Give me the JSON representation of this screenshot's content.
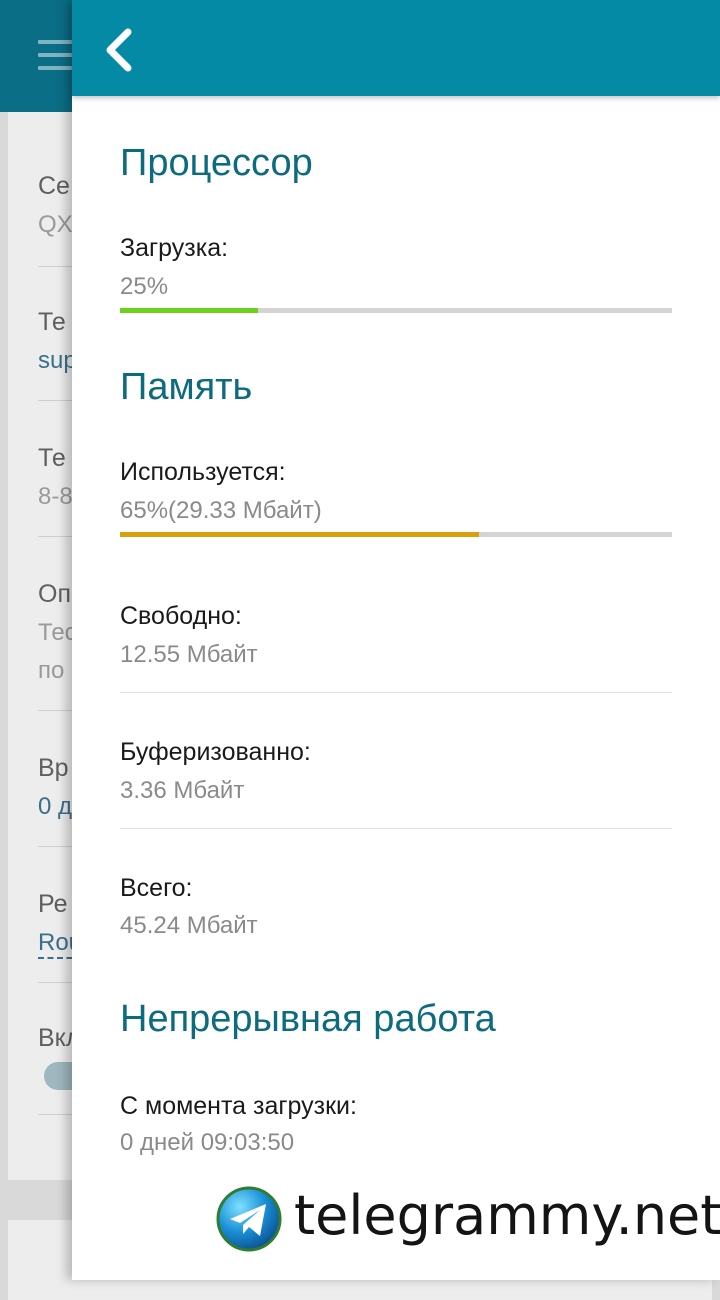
{
  "background": {
    "rows": [
      {
        "label": "Се",
        "value": "QX"
      },
      {
        "label": "Те",
        "value": "sup"
      },
      {
        "label": "Те",
        "value": "8-8"
      },
      {
        "label": "Оп",
        "value": "Тес",
        "value2": "по"
      },
      {
        "label": "Вр",
        "value": "0 д"
      },
      {
        "label": "Ре",
        "value": "Rou"
      },
      {
        "label": "Вкл"
      }
    ]
  },
  "cpu": {
    "title": "Процессор",
    "load_label": "Загрузка:",
    "load_value": "25%",
    "load_fraction": 0.25,
    "bar_color": "#6cd11a"
  },
  "memory": {
    "title": "Память",
    "used_label": "Используется:",
    "used_value": "65%(29.33 Мбайт)",
    "used_fraction": 0.65,
    "bar_color": "#d9a00e",
    "free_label": "Свободно:",
    "free_value": "12.55 Мбайт",
    "buffered_label": "Буферизованно:",
    "buffered_value": "3.36 Мбайт",
    "total_label": "Всего:",
    "total_value": "45.24 Мбайт"
  },
  "uptime": {
    "title": "Непрерывная работа",
    "since_label": "С момента загрузки:",
    "since_value": "0 дней 09:03:50"
  },
  "watermark": {
    "text": "telegrammy.net",
    "icon": "telegram-logo"
  },
  "colors": {
    "header": "#058aa6",
    "section_title": "#0c6b7e"
  }
}
